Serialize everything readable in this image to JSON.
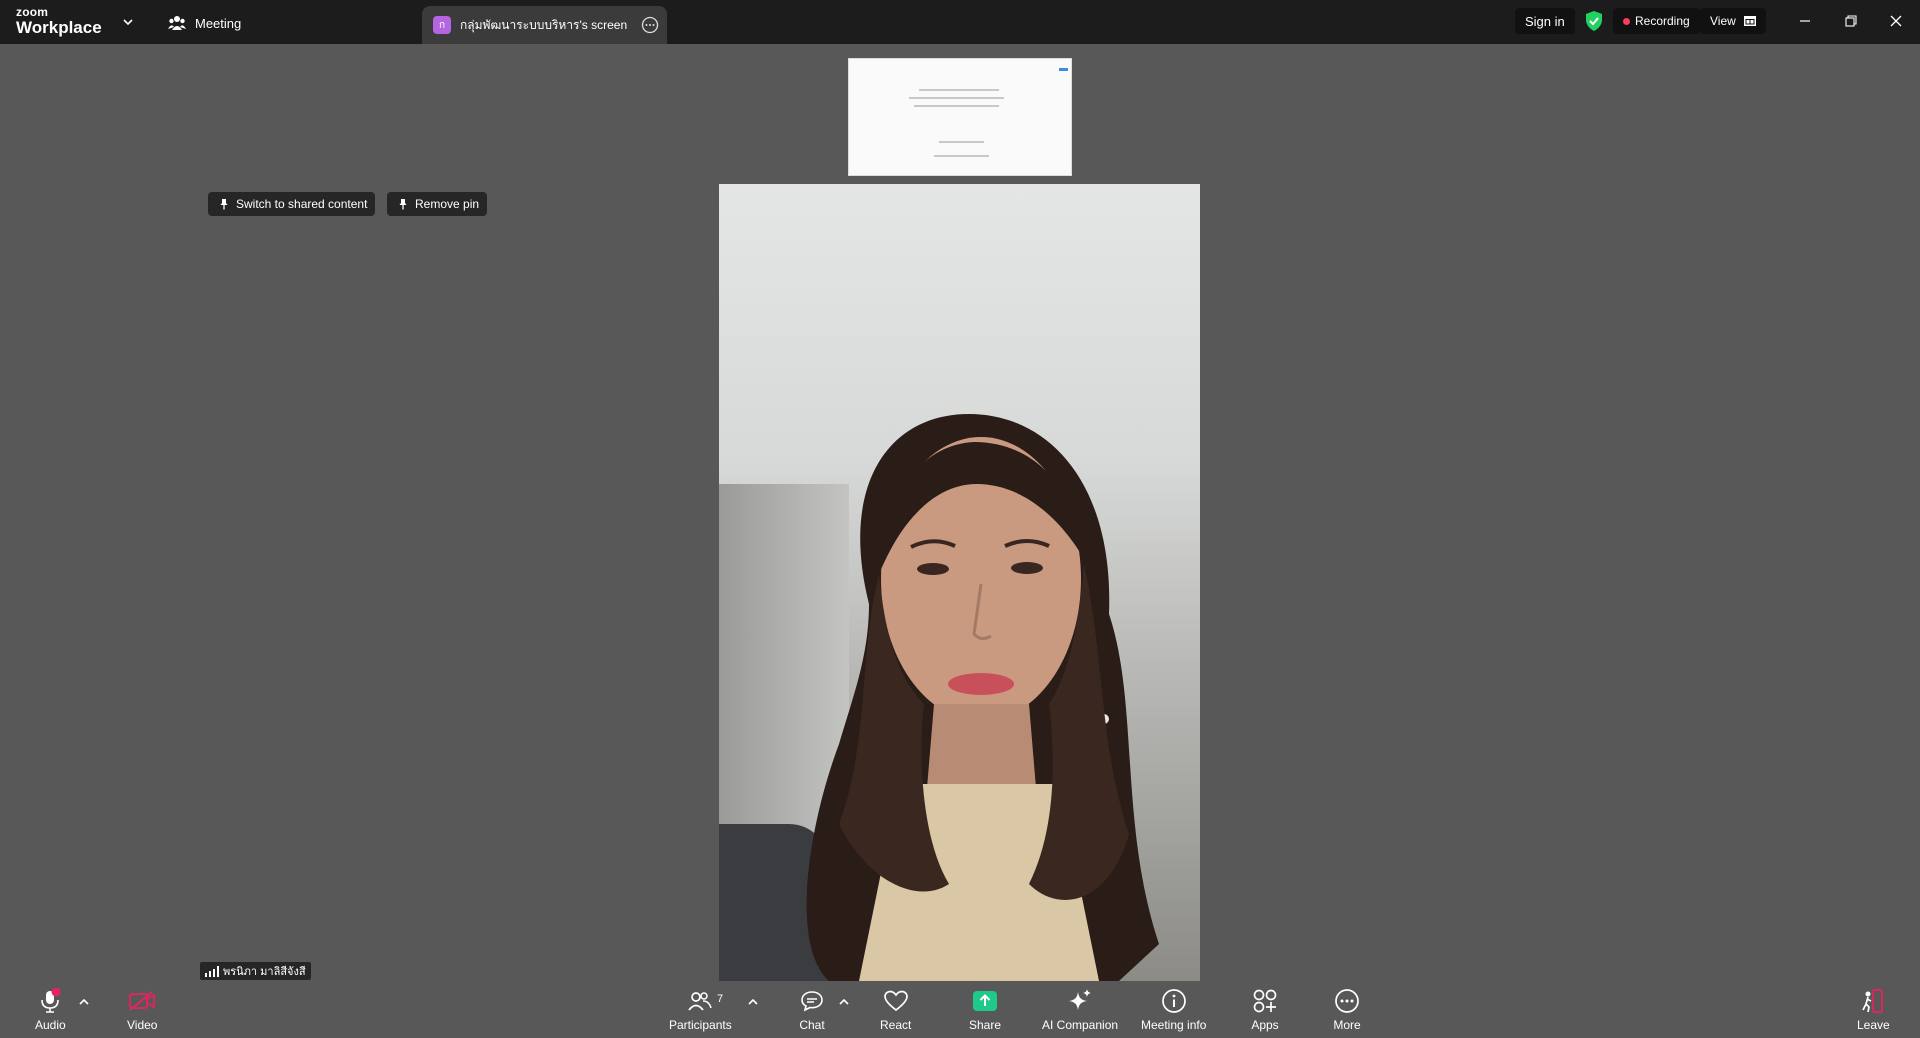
{
  "titlebar": {
    "logo_top": "zoom",
    "logo_bottom": "Workplace",
    "meeting_tab": "Meeting",
    "share_tab": {
      "badge": "ก",
      "label": "กลุ่มพัฒนาระบบบริหาร's screen"
    },
    "sign_in": "Sign in",
    "recording": "Recording",
    "view": "View"
  },
  "content": {
    "pin_buttons": {
      "switch": "Switch to shared content",
      "remove": "Remove pin"
    },
    "participant_name": "พรนิภา มาลิสีจังสี"
  },
  "toolbar": {
    "audio": "Audio",
    "video": "Video",
    "participants": "Participants",
    "participants_count": "7",
    "chat": "Chat",
    "react": "React",
    "share": "Share",
    "ai_companion": "AI Companion",
    "meeting_info": "Meeting info",
    "apps": "Apps",
    "more": "More",
    "leave": "Leave"
  },
  "colors": {
    "background": "#585858",
    "titlebar": "#1c1c1c",
    "share_green": "#1fc98a",
    "mute_red": "#e5245f",
    "security_green": "#23d160",
    "recording_red": "#ff3b5c"
  },
  "icons": [
    "chevron-down-icon",
    "people-icon",
    "more-icon",
    "shield-check-icon",
    "layout-icon",
    "minimize-icon",
    "restore-icon",
    "close-icon",
    "pin-icon",
    "signal-icon",
    "microphone-icon",
    "video-off-icon",
    "participants-icon",
    "chat-icon",
    "heart-icon",
    "share-arrow-icon",
    "sparkle-icon",
    "info-icon",
    "apps-icon",
    "leave-icon"
  ]
}
